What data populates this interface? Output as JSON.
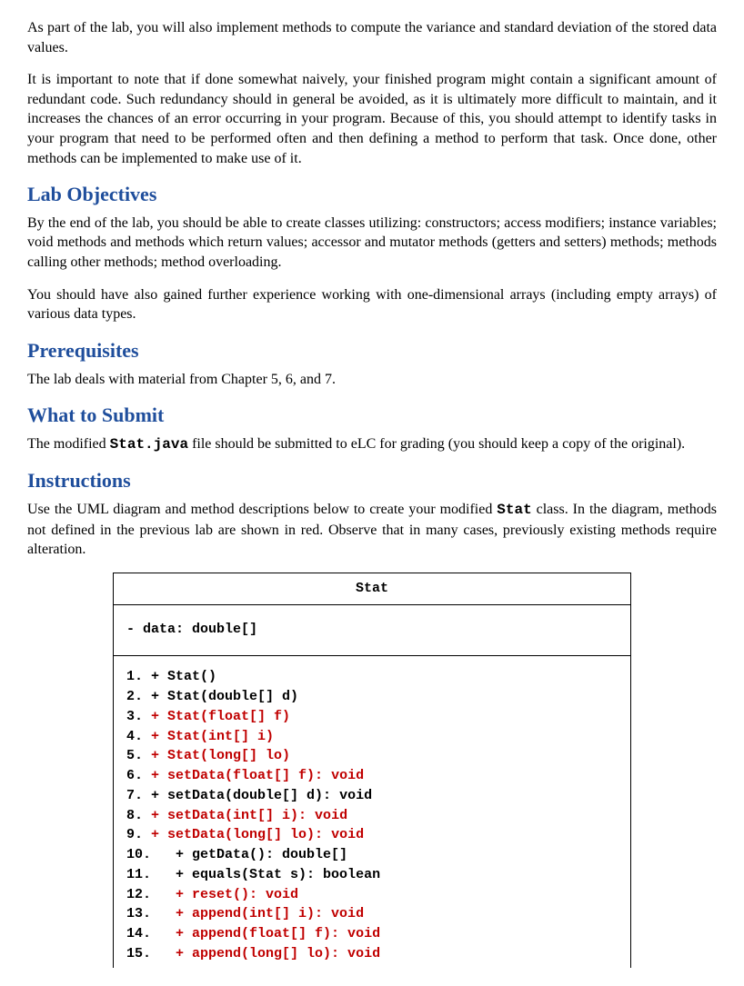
{
  "intro": {
    "p1": "As part of the lab, you will also implement methods to compute the variance and standard deviation of the stored data values.",
    "p2": "It is important to note that if done somewhat naively, your finished program might contain a significant amount of redundant code. Such redundancy should in general be avoided, as it is ultimately more difficult to maintain, and it increases the chances of an error occurring in your program. Because of this, you should attempt to identify tasks in your program that need to be performed often and then defining a method to perform that task. Once done, other methods can be implemented to make use of it."
  },
  "objectives": {
    "heading": "Lab Objectives",
    "p1": "By the end of the lab, you should be able to create classes utilizing:  constructors; access modifiers; instance variables; void methods and methods which return values; accessor and mutator methods (getters and setters) methods; methods calling other methods; method overloading.",
    "p2": "You should have also gained further experience working with one-dimensional arrays (including empty arrays) of various data types."
  },
  "prereq": {
    "heading": "Prerequisites",
    "p1": "The lab deals with material from Chapter 5, 6, and 7."
  },
  "submit": {
    "heading": "What to Submit",
    "before": "The modified ",
    "code": "Stat.java",
    "after": " file should be submitted to eLC for grading (you should keep a copy of the original)."
  },
  "instructions": {
    "heading": "Instructions",
    "before": "Use the UML diagram and method descriptions below to create your modified ",
    "code": "Stat",
    "after": " class. In the diagram, methods not defined in the previous lab are shown in red. Observe that in many cases, previously existing methods require alteration."
  },
  "uml": {
    "title": "Stat",
    "attr": "- data: double[]",
    "methods": [
      {
        "num": "1.",
        "sig": "+ Stat()",
        "red": false
      },
      {
        "num": "2.",
        "sig": "+ Stat(double[] d)",
        "red": false
      },
      {
        "num": "3.",
        "sig": "+ Stat(float[] f)",
        "red": true
      },
      {
        "num": "4.",
        "sig": "+ Stat(int[] i)",
        "red": true
      },
      {
        "num": "5.",
        "sig": "+ Stat(long[] lo)",
        "red": true
      },
      {
        "num": "6.",
        "sig": "+ setData(float[] f): void",
        "red": true
      },
      {
        "num": "7.",
        "sig": "+ setData(double[] d): void",
        "red": false
      },
      {
        "num": "8.",
        "sig": "+ setData(int[] i): void",
        "red": true
      },
      {
        "num": "9.",
        "sig": "+ setData(long[] lo): void",
        "red": true
      },
      {
        "num": "10.",
        "sig": "+ getData(): double[]",
        "red": false
      },
      {
        "num": "11.",
        "sig": "+ equals(Stat s): boolean",
        "red": false
      },
      {
        "num": "12.",
        "sig": "+ reset(): void",
        "red": true
      },
      {
        "num": "13.",
        "sig": "+ append(int[] i): void",
        "red": true
      },
      {
        "num": "14.",
        "sig": "+ append(float[] f): void",
        "red": true
      },
      {
        "num": "15.",
        "sig": "+ append(long[] lo): void",
        "red": true
      }
    ]
  }
}
